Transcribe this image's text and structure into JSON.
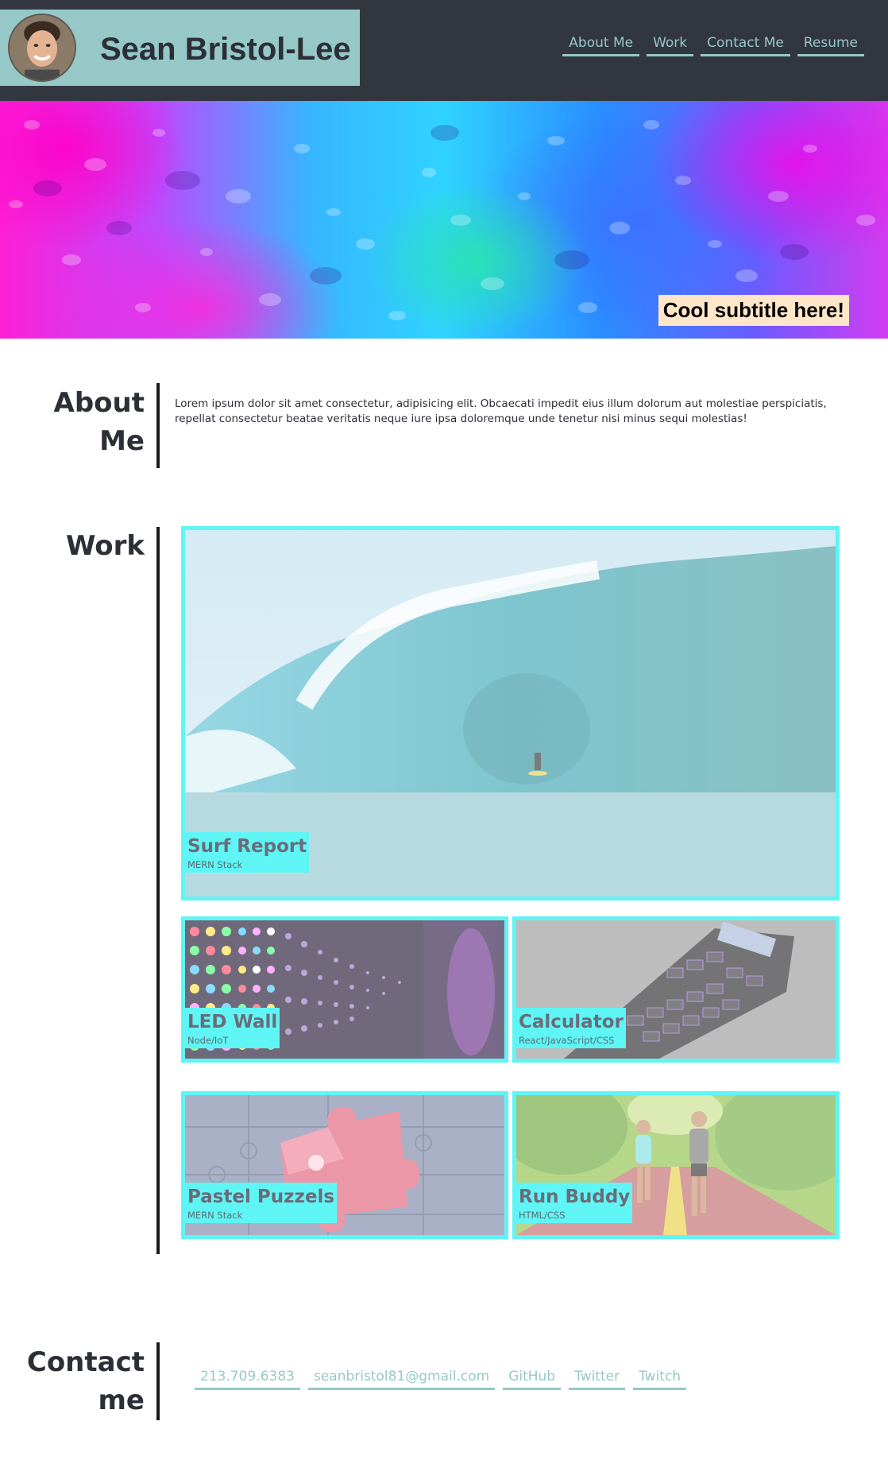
{
  "header": {
    "name": "Sean Bristol-Lee",
    "nav": [
      {
        "label": "About Me"
      },
      {
        "label": "Work"
      },
      {
        "label": "Contact Me"
      },
      {
        "label": "Resume"
      }
    ]
  },
  "hero": {
    "subtitle": "Cool subtitle here!"
  },
  "about": {
    "title_line1": "About",
    "title_line2": "Me",
    "text": "Lorem ipsum dolor sit amet consectetur, adipisicing elit. Obcaecati impedit eius illum dolorum aut molestiae perspiciatis, repellat consectetur beatae veritatis neque iure ipsa doloremque unde tenetur nisi minus sequi molestias!"
  },
  "work": {
    "title": "Work",
    "projects": [
      {
        "title": "Surf Report",
        "stack": "MERN Stack"
      },
      {
        "title": "LED Wall",
        "stack": "Node/IoT"
      },
      {
        "title": "Calculator",
        "stack": "React/JavaScript/CSS"
      },
      {
        "title": "Pastel Puzzels",
        "stack": "MERN Stack"
      },
      {
        "title": "Run Buddy",
        "stack": "HTML/CSS"
      }
    ]
  },
  "contact": {
    "title_line1": "Contact",
    "title_line2": "me",
    "links": [
      {
        "label": "213.709.6383"
      },
      {
        "label": "seanbristol81@gmail.com"
      },
      {
        "label": "GitHub"
      },
      {
        "label": "Twitter"
      },
      {
        "label": "Twitch"
      }
    ]
  },
  "colors": {
    "header_bg": "#32363f",
    "brand_bg": "#96c8c8",
    "accent": "#5ff5f5",
    "link": "#96c8c8",
    "subtitle_bg": "#ffe6c8"
  }
}
